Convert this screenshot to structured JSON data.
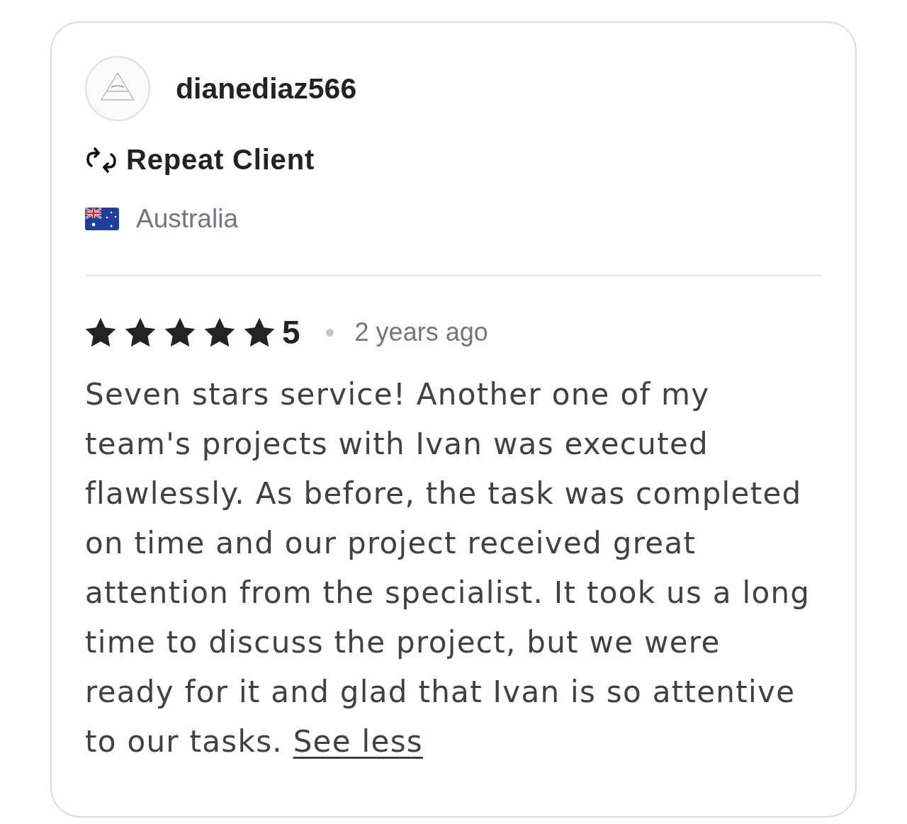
{
  "reviewer": {
    "username": "dianediaz566",
    "badge": "Repeat Client",
    "country": "Australia"
  },
  "review": {
    "stars": 5,
    "rating": "5",
    "time": "2 years ago",
    "text": "Seven stars service! Another one of my team's projects with Ivan was executed flawlessly. As before, the task was completed on time and our project received great attention from the specialist. It took us a long time to discuss the project, but we were ready for it and glad that Ivan is so attentive to our tasks.",
    "link": "See less"
  }
}
